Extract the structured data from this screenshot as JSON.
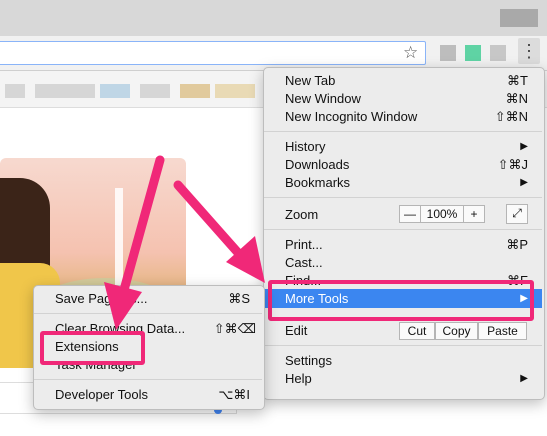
{
  "main_menu": {
    "new_tab": {
      "label": "New Tab",
      "shortcut": "⌘T"
    },
    "new_window": {
      "label": "New Window",
      "shortcut": "⌘N"
    },
    "new_incognito": {
      "label": "New Incognito Window",
      "shortcut": "⇧⌘N"
    },
    "history": {
      "label": "History",
      "arrow": "▶"
    },
    "downloads": {
      "label": "Downloads",
      "shortcut": "⇧⌘J"
    },
    "bookmarks": {
      "label": "Bookmarks",
      "arrow": "▶"
    },
    "zoom": {
      "label": "Zoom",
      "minus": "—",
      "value": "100%",
      "plus": "+",
      "fullscreen": "⤢"
    },
    "print": {
      "label": "Print...",
      "shortcut": "⌘P"
    },
    "cast": {
      "label": "Cast..."
    },
    "find": {
      "label": "Find...",
      "shortcut": "⌘F"
    },
    "more_tools": {
      "label": "More Tools",
      "arrow": "▶"
    },
    "edit": {
      "label": "Edit",
      "cut": "Cut",
      "copy": "Copy",
      "paste": "Paste"
    },
    "settings": {
      "label": "Settings"
    },
    "help": {
      "label": "Help",
      "arrow": "▶"
    }
  },
  "submenu": {
    "save_page": {
      "label": "Save Page As...",
      "shortcut": "⌘S"
    },
    "clear_data": {
      "label": "Clear Browsing Data...",
      "shortcut": "⇧⌘⌫"
    },
    "extensions": {
      "label": "Extensions"
    },
    "task_manager": {
      "label": "Task Manager"
    },
    "developer_tools": {
      "label": "Developer Tools",
      "shortcut": "⌥⌘I"
    }
  },
  "toolbar": {
    "star_icon": "☆",
    "menu_icon": "⋮"
  },
  "colors": {
    "highlight": "#3b86f0",
    "annotation": "#f02878"
  }
}
